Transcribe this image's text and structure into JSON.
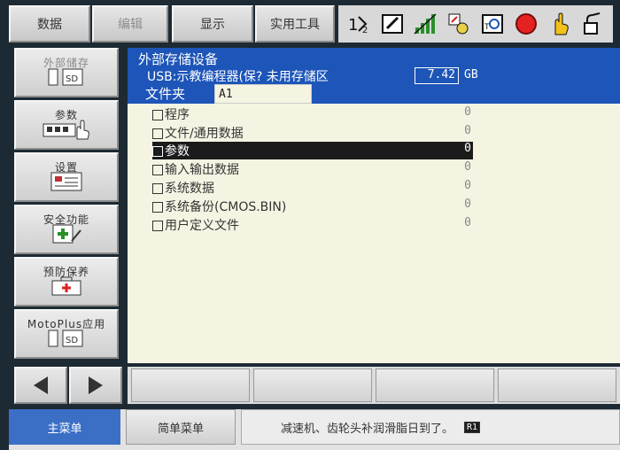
{
  "top_menu": {
    "data": "数据",
    "edit": "编辑",
    "display": "显示",
    "utility": "实用工具"
  },
  "status_icons": [
    "axis-switch-icon",
    "edit-mode-icon",
    "speed-bars-icon",
    "coordinate-icon",
    "robot-tool-icon",
    "stop-icon",
    "hand-pointer-icon",
    "lock-icon"
  ],
  "side_menu": {
    "external_storage": "外部储存",
    "parameters": "参数",
    "settings": "设置",
    "safety": "安全功能",
    "maintenance": "预防保养",
    "motoplus": "MotoPlus应用"
  },
  "panel": {
    "title": "外部存储设备",
    "usb_label": "USB:示教编程器(保? 未用存储区",
    "capacity": "7.42",
    "capacity_unit": "GB",
    "folder_label": "文件夹",
    "folder_value": "A1",
    "items": [
      {
        "label": "程序",
        "count": "0"
      },
      {
        "label": "文件/通用数据",
        "count": "0"
      },
      {
        "label": "参数",
        "count": "0"
      },
      {
        "label": "输入输出数据",
        "count": "0"
      },
      {
        "label": "系统数据",
        "count": "0"
      },
      {
        "label": "系统备份(CMOS.BIN)",
        "count": "0"
      },
      {
        "label": "用户定义文件",
        "count": "0"
      }
    ],
    "selected_index": 2
  },
  "bottom": {
    "main_menu": "主菜单",
    "simple_menu": "简单菜单",
    "message": "减速机、齿轮头补润滑脂日到了。",
    "message_tag": "R1"
  },
  "colors": {
    "header_blue": "#1d55b8",
    "panel_bg": "#f5f4e3",
    "main_menu_blue": "#3b6fc6"
  }
}
